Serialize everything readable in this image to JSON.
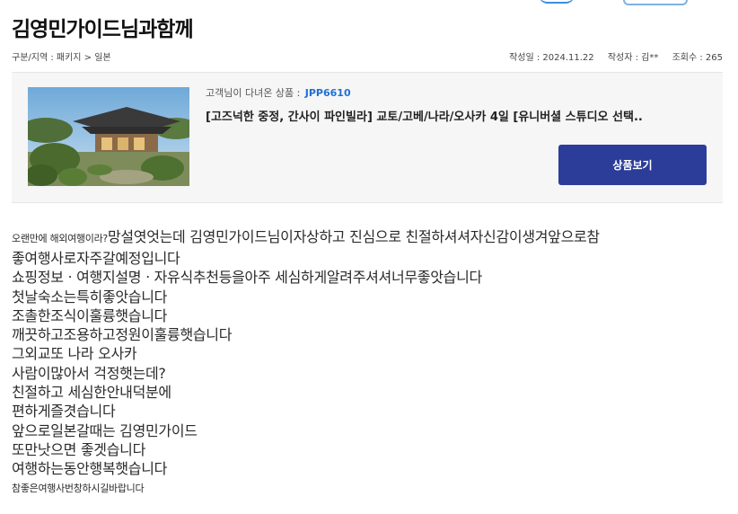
{
  "page": {
    "title": "김영민가이드님과함께"
  },
  "meta": {
    "category": "구분/지역 : 패키지 > 일본",
    "date": "작성일 : 2024.11.22",
    "author": "작성자 : 김**",
    "views": "조회수 : 265"
  },
  "product": {
    "visited_label": "고객님이 다녀온 상품 :",
    "code": "JPP6610",
    "name": "[고즈넉한 중정, 간사이 파인빌라] 교토/고베/나라/오사카 4일 [유니버셜 스튜디오 선택..",
    "button_label": "상품보기",
    "thumbnail_icon": "temple-garden-photo"
  },
  "review": {
    "intro_small": "오랜만에 해외여행이라?",
    "intro_rest": "망설엿엇는데 김영민가이드님이자상하고 진심으로 친절하셔셔자신감이생겨앞으로참",
    "lines": [
      "좋여행사로자주갈예정입니다",
      "쇼핑정보ㆍ여행지설명ㆍ자유식추천등을아주 세심하게알려주셔셔너무좋앗습니다",
      "첫날숙소는특히좋앗습니다",
      "조촐한조식이훌륭햇습니다",
      "깨끗하고조용하고정원이훌륭햇습니다",
      "그외교또 나라 오사카",
      "사람이많아서 걱정햇는데?",
      "친절하고 세심한안내덕분에",
      "편하게즐겻습니다",
      "앞으로일본갈때는 김영민가이드",
      "또만낫으면 좋겟습니다",
      "여행하는동안행복햇습니다"
    ],
    "closing_small": "참좋은여행사번창하시길바랍니다"
  }
}
